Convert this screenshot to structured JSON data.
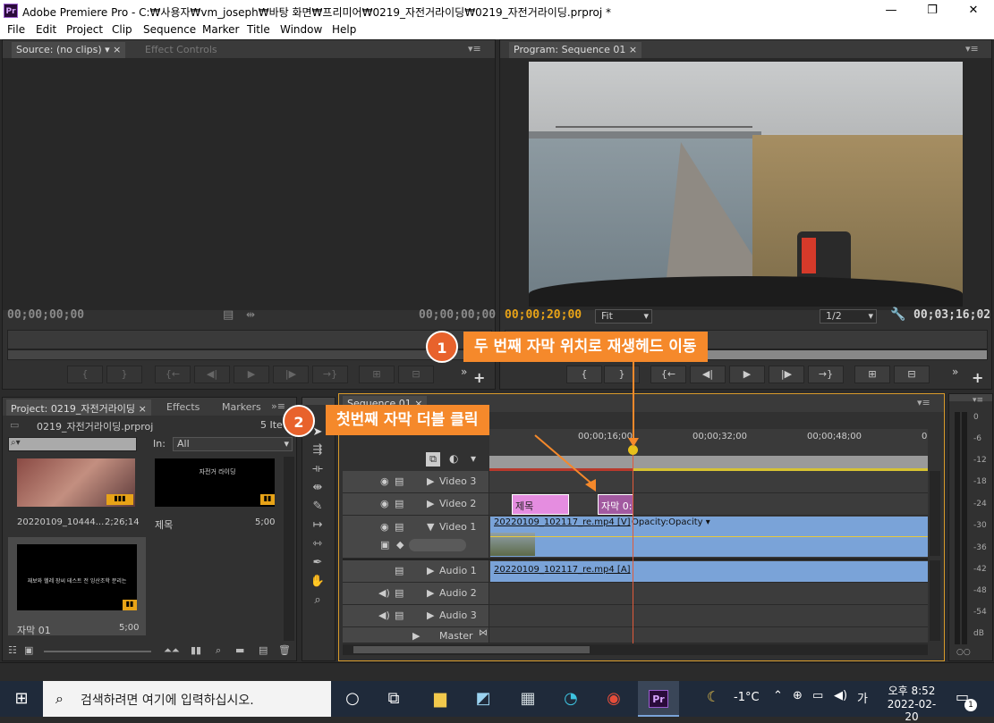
{
  "window": {
    "title": "Adobe Premiere Pro - C:₩사용자₩vm_joseph₩바탕 화면₩프리미어₩0219_자전거라이딩₩0219_자전거라이딩.prproj *",
    "app_icon": "Pr"
  },
  "menu": [
    "File",
    "Edit",
    "Project",
    "Clip",
    "Sequence",
    "Marker",
    "Title",
    "Window",
    "Help"
  ],
  "source_panel": {
    "tabs": [
      "Source: (no clips)",
      "Effect Controls"
    ],
    "tc_left": "00;00;00;00",
    "tc_right": "00;00;00;00"
  },
  "program_panel": {
    "tab": "Program: Sequence 01",
    "tc_current": "00;00;20;00",
    "fit": "Fit",
    "res": "1/2",
    "tc_duration": "00;03;16;02"
  },
  "project_panel": {
    "tabs": [
      "Project: 0219_자전거라이딩",
      "Effects",
      "Markers"
    ],
    "project_file": "0219_자전거라이딩.prproj",
    "count": "5 Ite",
    "in_label": "In:",
    "in_value": "All",
    "items": [
      {
        "name": "20220109_10444...",
        "duration": "2;26;14"
      },
      {
        "name": "제목",
        "duration": "5;00",
        "thumb_text": "자전거 라이딩"
      },
      {
        "name": "자막 01",
        "duration": "5;00",
        "thumb_text": "재보와 헬레 장씨 테스트 전 잉산조학 분리는"
      }
    ]
  },
  "timeline": {
    "tab": "Sequence 01",
    "ruler": [
      "00;00;16;00",
      "00;00;32;00",
      "00;00;48;00",
      "0"
    ],
    "tracks": [
      {
        "name": "Video 3"
      },
      {
        "name": "Video 2",
        "clips": [
          "제목",
          "자막 0:"
        ]
      },
      {
        "name": "Video 1",
        "clip": "20220109_102117_re.mp4 [V]",
        "fx": "Opacity:Opacity ▾"
      },
      {
        "name": "Audio 1",
        "clip": "20220109_102117_re.mp4 [A]"
      },
      {
        "name": "Audio 2"
      },
      {
        "name": "Audio 3"
      },
      {
        "name": "Master"
      }
    ]
  },
  "meter": {
    "labels": [
      "0",
      "-6",
      "-12",
      "-18",
      "-24",
      "-30",
      "-36",
      "-42",
      "-48",
      "-54",
      "dB"
    ]
  },
  "callouts": [
    {
      "num": "1",
      "text": "두 번째 자막 위치로 재생헤드 이동"
    },
    {
      "num": "2",
      "text": "첫번째 자막 더블 클릭"
    }
  ],
  "taskbar": {
    "search": "검색하려면 여기에 입력하십시오.",
    "weather": "-1°C",
    "ime": "가",
    "time": "오후 8:52",
    "date": "2022-02-20",
    "notif": "1"
  },
  "colors": {
    "accent": "#f5892b",
    "timecode": "#e8a317",
    "clip_video": "#7aa3d8",
    "clip_title": "#e58de0"
  }
}
